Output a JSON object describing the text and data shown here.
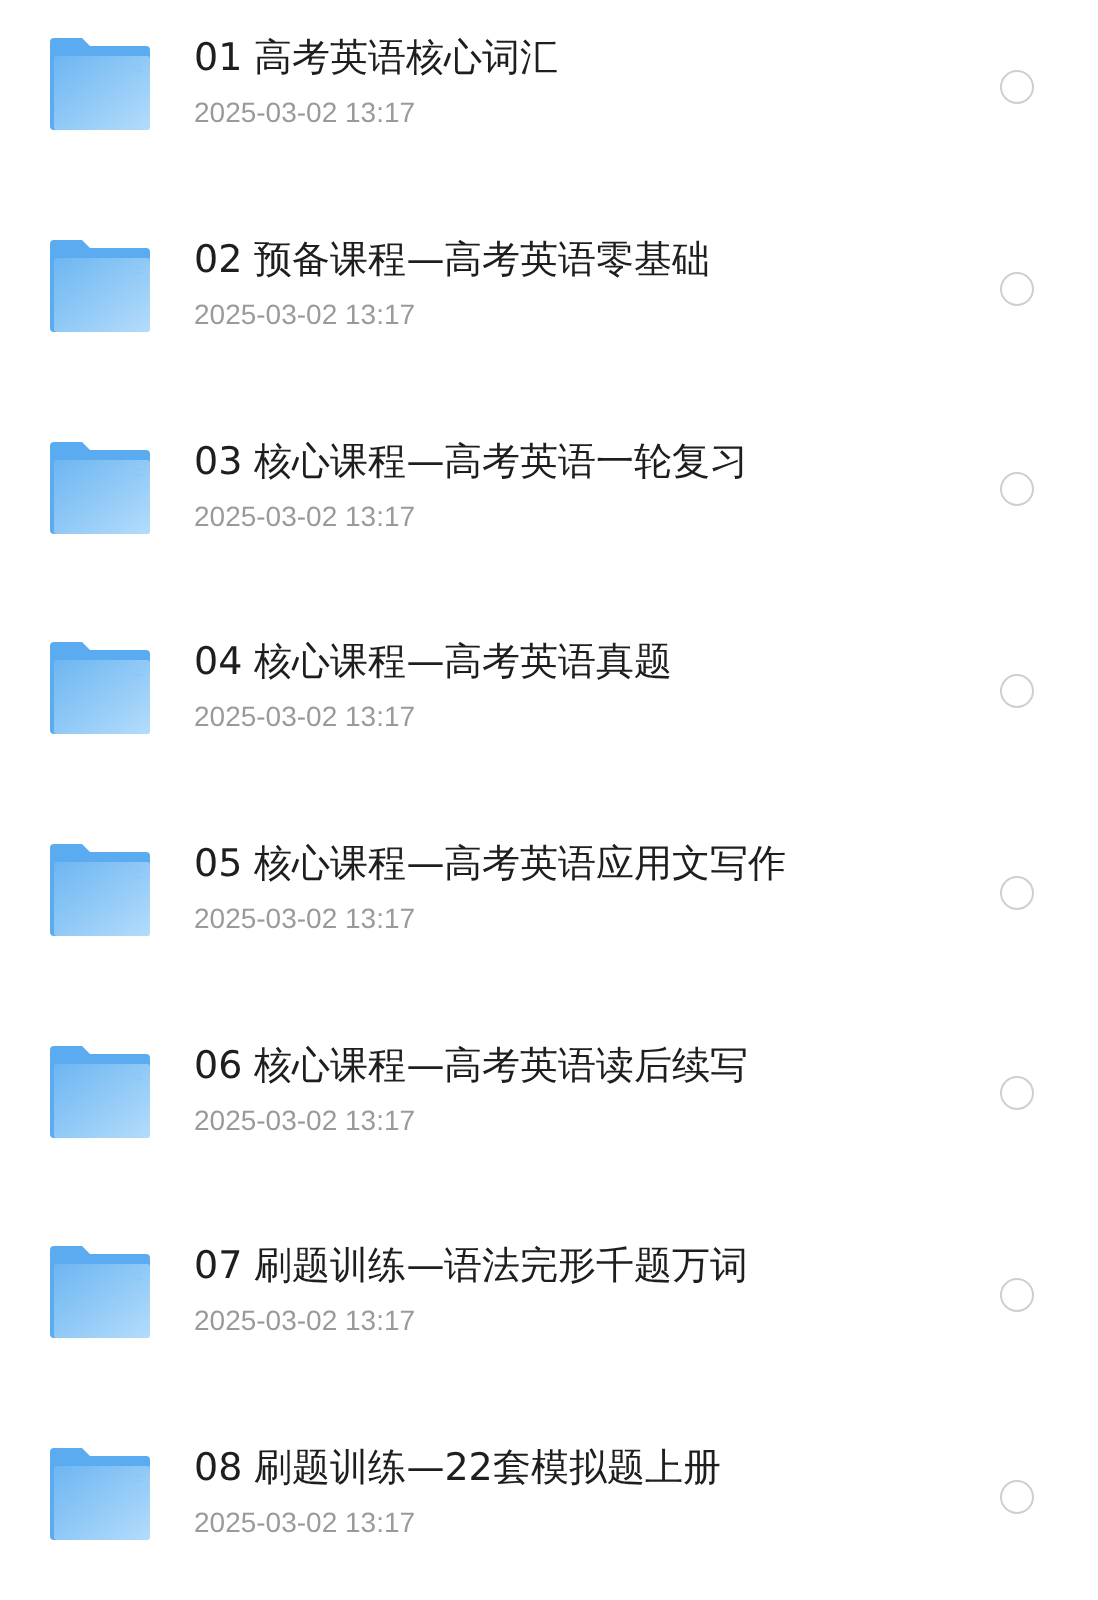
{
  "files": [
    {
      "name": "01 高考英语核心词汇",
      "date": "2025-03-02 13:17",
      "selected": false
    },
    {
      "name": "02 预备课程—高考英语零基础",
      "date": "2025-03-02 13:17",
      "selected": false
    },
    {
      "name": "03 核心课程—高考英语一轮复习",
      "date": "2025-03-02 13:17",
      "selected": false
    },
    {
      "name": "04 核心课程—高考英语真题",
      "date": "2025-03-02 13:17",
      "selected": false
    },
    {
      "name": "05 核心课程—高考英语应用文写作",
      "date": "2025-03-02 13:17",
      "selected": false
    },
    {
      "name": "06 核心课程—高考英语读后续写",
      "date": "2025-03-02 13:17",
      "selected": false
    },
    {
      "name": "07 刷题训练—语法完形千题万词",
      "date": "2025-03-02 13:17",
      "selected": false
    },
    {
      "name": "08 刷题训练—22套模拟题上册",
      "date": "2025-03-02 13:17",
      "selected": false
    }
  ]
}
